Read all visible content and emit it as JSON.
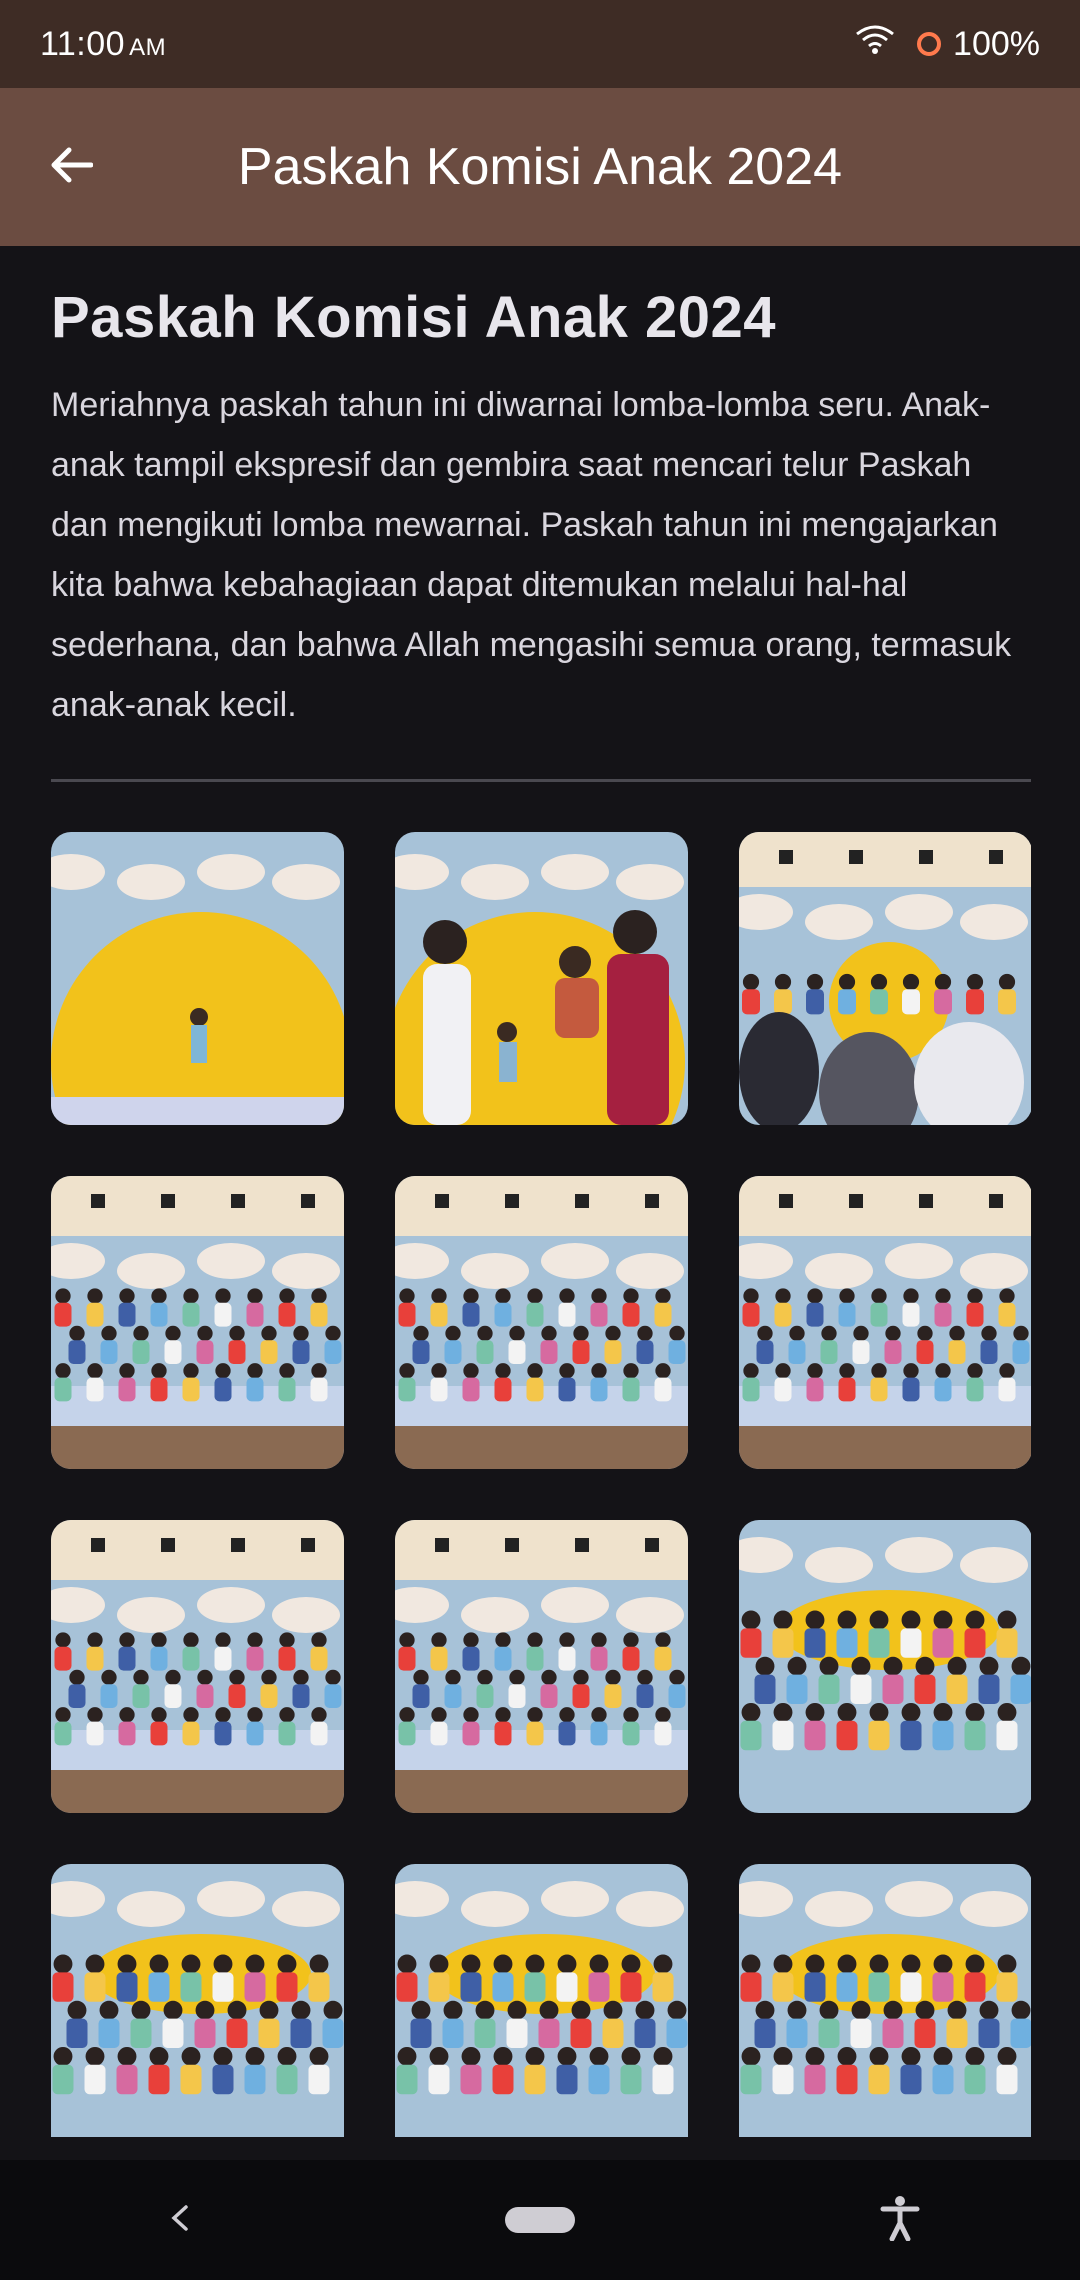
{
  "status_bar": {
    "time": "11:00",
    "ampm": "AM",
    "battery": "100%",
    "icons": [
      "wifi-icon",
      "battery-ring-icon"
    ]
  },
  "app_bar": {
    "title": "Paskah Komisi Anak 2024",
    "back_icon": "arrow-left-icon"
  },
  "article": {
    "title": "Paskah Komisi Anak 2024",
    "description": "Meriahnya paskah tahun ini diwarnai lomba-lomba seru. Anak-anak tampil ekspresif dan gembira saat mencari telur Paskah dan mengikuti lomba mewarnai. Paskah tahun ini mengajarkan kita bahwa kebahagiaan dapat ditemukan melalui hal-hal sederhana, dan bahwa Allah mengasihi semua orang, termasuk anak-anak kecil."
  },
  "gallery": {
    "photos": [
      {
        "kind": "stage-sun-child"
      },
      {
        "kind": "stage-adults-children"
      },
      {
        "kind": "audience-crowd"
      },
      {
        "kind": "group-stage"
      },
      {
        "kind": "group-stage"
      },
      {
        "kind": "group-stage"
      },
      {
        "kind": "group-stage"
      },
      {
        "kind": "group-stage"
      },
      {
        "kind": "group-closeup"
      },
      {
        "kind": "group-closeup"
      },
      {
        "kind": "group-closeup"
      },
      {
        "kind": "group-closeup"
      }
    ]
  },
  "nav_bar": {
    "icons": [
      "nav-back-icon",
      "home-pill-icon",
      "accessibility-icon"
    ]
  },
  "colors": {
    "status_bar": "#3e2c25",
    "app_bar": "#6b4c41",
    "background": "#141317",
    "text_primary": "#e8e6ec"
  }
}
